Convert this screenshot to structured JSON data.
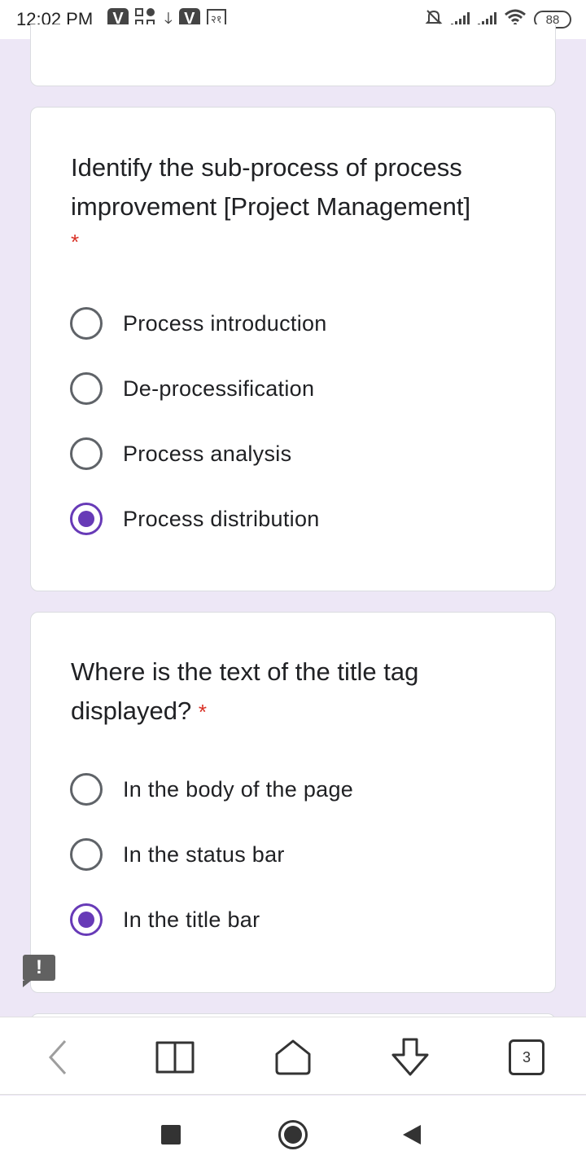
{
  "status_bar": {
    "time": "12:02 PM",
    "left_icons": [
      "v-app-icon",
      "grid-app-icon",
      "download-icon",
      "v-app-icon",
      "rupee-icon"
    ],
    "v_letter": "V",
    "rupee_text": "२१",
    "right_icons": [
      "mute-bell-icon",
      "signal-icon",
      "signal-icon",
      "wifi-icon",
      "battery-icon"
    ],
    "battery": "88"
  },
  "questions": [
    {
      "title": "Identify the sub-process of process improvement [Project Management]",
      "required_mark": "*",
      "options": [
        {
          "label": "Process introduction",
          "selected": false
        },
        {
          "label": "De-processification",
          "selected": false
        },
        {
          "label": "Process analysis",
          "selected": false
        },
        {
          "label": "Process distribution",
          "selected": true
        }
      ]
    },
    {
      "title": "Where is the text of the title tag displayed?",
      "required_mark": "*",
      "options": [
        {
          "label": "In the body of the page",
          "selected": false
        },
        {
          "label": "In the status bar",
          "selected": false
        },
        {
          "label": "In the title bar",
          "selected": true
        }
      ]
    }
  ],
  "feedback_icon": "!",
  "toolbar": {
    "buttons": [
      "back-icon",
      "bookmarks-icon",
      "home-icon",
      "download-icon",
      "tabs-icon"
    ],
    "tab_count": "3"
  },
  "nav_bar": {
    "buttons": [
      "recents-icon",
      "home-icon",
      "back-icon"
    ]
  },
  "colors": {
    "background": "#ede7f6",
    "accent": "#673ab7",
    "required": "#d93025"
  }
}
